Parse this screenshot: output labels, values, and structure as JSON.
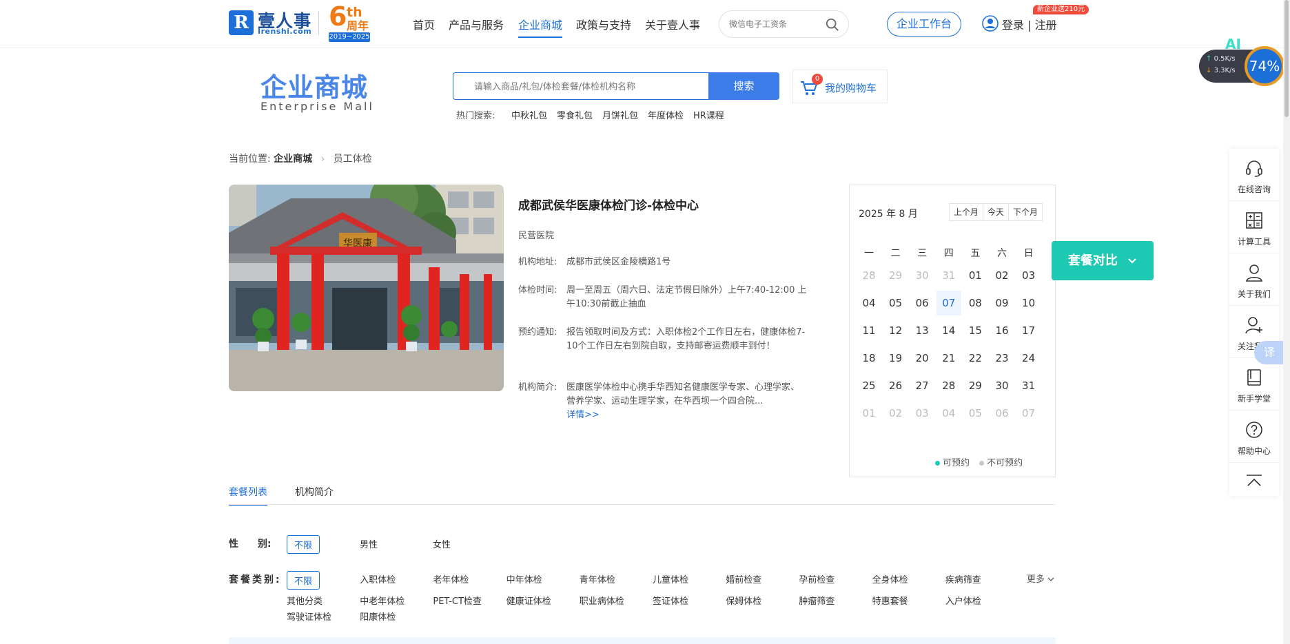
{
  "brand": {
    "logo_letter": "R",
    "name": "壹人事",
    "domain": "Irenshi.com",
    "anniversary_number": "6",
    "anniversary_suffix": "th",
    "anniversary_word": "周年",
    "anniversary_years": "2019~2025"
  },
  "nav": {
    "items": [
      "首页",
      "产品与服务",
      "企业商城",
      "政策与支持",
      "关于壹人事"
    ],
    "active_index": 2,
    "search_placeholder": "微信电子工资条",
    "workbench_label": "企业工作台",
    "promo_badge": "新企业送210元",
    "login_label": "登录 | 注册"
  },
  "speed_widget": {
    "ai_label": "AI",
    "upload": "0.5K/s",
    "download": "3.3K/s",
    "percent": "74%"
  },
  "mall": {
    "title": "企业商城",
    "subtitle": "Enterprise  Mall",
    "search_placeholder": "请输入商品/礼包/体检套餐/体检机构名称",
    "search_button": "搜索",
    "cart_count": "0",
    "cart_label": "我的购物车",
    "hot_label": "热门搜索:",
    "hot_items": [
      "中秋礼包",
      "零食礼包",
      "月饼礼包",
      "年度体检",
      "HR课程"
    ]
  },
  "breadcrumb": {
    "prefix": "当前位置:",
    "level1": "企业商城",
    "level2": "员工体检"
  },
  "hospital": {
    "name": "成都武侯华医康体检门诊-体检中心",
    "type": "民营医院",
    "sign_text": "华医康",
    "address_label": "机构地址:",
    "address": "成都市武侯区金陵横路1号",
    "hours_label": "体检时间:",
    "hours": "周一至周五（周六日、法定节假日除外）上午7:40-12:00 上午10:30前截止抽血",
    "notice_label": "预约通知:",
    "notice": "报告领取时间及方式：入职体检2个工作日左右，健康体检7-10个工作日左右到院自取，支持邮寄运费顺丰到付！",
    "intro_label": "机构简介:",
    "intro": "医康医学体检中心携手华西知名健康医学专家、心理学家、营养学家、运动生理学家，在华西坝一个四合院...",
    "detail_link": "详情>>"
  },
  "calendar": {
    "title": "2025 年 8 月",
    "prev_label": "上个月",
    "today_label": "今天",
    "next_label": "下个月",
    "weekdays": [
      "一",
      "二",
      "三",
      "四",
      "五",
      "六",
      "日"
    ],
    "weeks": [
      [
        {
          "d": "28",
          "m": true
        },
        {
          "d": "29",
          "m": true
        },
        {
          "d": "30",
          "m": true
        },
        {
          "d": "31",
          "m": true
        },
        {
          "d": "01"
        },
        {
          "d": "02"
        },
        {
          "d": "03"
        }
      ],
      [
        {
          "d": "04"
        },
        {
          "d": "05"
        },
        {
          "d": "06"
        },
        {
          "d": "07",
          "t": true
        },
        {
          "d": "08"
        },
        {
          "d": "09"
        },
        {
          "d": "10"
        }
      ],
      [
        {
          "d": "11"
        },
        {
          "d": "12"
        },
        {
          "d": "13"
        },
        {
          "d": "14"
        },
        {
          "d": "15"
        },
        {
          "d": "16"
        },
        {
          "d": "17"
        }
      ],
      [
        {
          "d": "18"
        },
        {
          "d": "19"
        },
        {
          "d": "20"
        },
        {
          "d": "21"
        },
        {
          "d": "22"
        },
        {
          "d": "23"
        },
        {
          "d": "24"
        }
      ],
      [
        {
          "d": "25"
        },
        {
          "d": "26"
        },
        {
          "d": "27"
        },
        {
          "d": "28"
        },
        {
          "d": "29"
        },
        {
          "d": "30"
        },
        {
          "d": "31"
        }
      ],
      [
        {
          "d": "01",
          "m": true
        },
        {
          "d": "02",
          "m": true
        },
        {
          "d": "03",
          "m": true
        },
        {
          "d": "04",
          "m": true
        },
        {
          "d": "05",
          "m": true
        },
        {
          "d": "06",
          "m": true
        },
        {
          "d": "07",
          "m": true
        }
      ]
    ],
    "legend_available": "可预约",
    "legend_unavailable": "不可预约",
    "available_color": "#1dc9b2",
    "unavailable_color": "#c8c8c8"
  },
  "compare_button": "套餐对比",
  "sidebar": {
    "items": [
      {
        "label": "在线咨询",
        "icon": "headset-icon"
      },
      {
        "label": "计算工具",
        "icon": "calculator-icon"
      },
      {
        "label": "关于我们",
        "icon": "person-icon"
      },
      {
        "label": "关注我们",
        "icon": "follow-icon"
      },
      {
        "label": "新手学堂",
        "icon": "book-icon"
      },
      {
        "label": "帮助中心",
        "icon": "help-icon"
      }
    ],
    "translate_label": "译"
  },
  "tabs": {
    "packages": "套餐列表",
    "intro": "机构简介"
  },
  "filters": {
    "gender_label": "性　　别:",
    "gender_options": [
      "不限",
      "男性",
      "女性"
    ],
    "category_label": "套餐类别:",
    "category_row1": [
      "不限",
      "入职体检",
      "老年体检",
      "中年体检",
      "青年体检",
      "儿童体检",
      "婚前检查",
      "孕前检查",
      "全身体检",
      "疾病筛查"
    ],
    "category_row2": [
      "其他分类",
      "中老年体检",
      "PET-CT检查",
      "健康证体检",
      "职业病体检",
      "签证体检",
      "保姆体检",
      "肿瘤筛查",
      "特惠套餐",
      "入户体检"
    ],
    "category_row3": [
      "驾驶证体检",
      "阳康体检"
    ],
    "more_label": "更多"
  },
  "colors": {
    "brand_blue": "#1d6fd8",
    "accent_teal": "#1dc9b2",
    "anniversary_orange": "#f07a15",
    "badge_red": "#f04b3a"
  }
}
